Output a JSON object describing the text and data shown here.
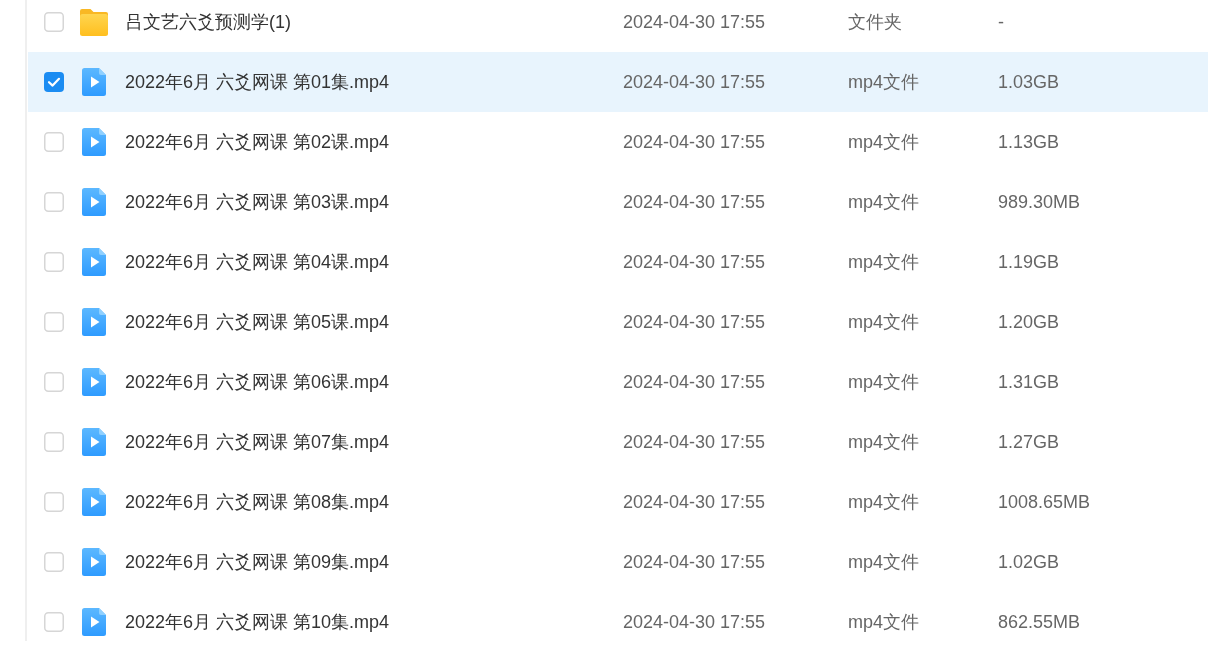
{
  "file_list": {
    "rows": [
      {
        "kind": "folder",
        "selected": false,
        "name": "吕文艺六爻预测学(1)",
        "modified": "2024-04-30 17:55",
        "type": "文件夹",
        "size": "-"
      },
      {
        "kind": "video",
        "selected": true,
        "name": "2022年6月 六爻网课 第01集.mp4",
        "modified": "2024-04-30 17:55",
        "type": "mp4文件",
        "size": "1.03GB"
      },
      {
        "kind": "video",
        "selected": false,
        "name": "2022年6月 六爻网课 第02课.mp4",
        "modified": "2024-04-30 17:55",
        "type": "mp4文件",
        "size": "1.13GB"
      },
      {
        "kind": "video",
        "selected": false,
        "name": "2022年6月 六爻网课 第03课.mp4",
        "modified": "2024-04-30 17:55",
        "type": "mp4文件",
        "size": "989.30MB"
      },
      {
        "kind": "video",
        "selected": false,
        "name": "2022年6月 六爻网课 第04课.mp4",
        "modified": "2024-04-30 17:55",
        "type": "mp4文件",
        "size": "1.19GB"
      },
      {
        "kind": "video",
        "selected": false,
        "name": "2022年6月 六爻网课 第05课.mp4",
        "modified": "2024-04-30 17:55",
        "type": "mp4文件",
        "size": "1.20GB"
      },
      {
        "kind": "video",
        "selected": false,
        "name": "2022年6月 六爻网课 第06课.mp4",
        "modified": "2024-04-30 17:55",
        "type": "mp4文件",
        "size": "1.31GB"
      },
      {
        "kind": "video",
        "selected": false,
        "name": "2022年6月 六爻网课 第07集.mp4",
        "modified": "2024-04-30 17:55",
        "type": "mp4文件",
        "size": "1.27GB"
      },
      {
        "kind": "video",
        "selected": false,
        "name": "2022年6月 六爻网课 第08集.mp4",
        "modified": "2024-04-30 17:55",
        "type": "mp4文件",
        "size": "1008.65MB"
      },
      {
        "kind": "video",
        "selected": false,
        "name": "2022年6月 六爻网课 第09集.mp4",
        "modified": "2024-04-30 17:55",
        "type": "mp4文件",
        "size": "1.02GB"
      },
      {
        "kind": "video",
        "selected": false,
        "name": "2022年6月 六爻网课 第10集.mp4",
        "modified": "2024-04-30 17:55",
        "type": "mp4文件",
        "size": "862.55MB"
      }
    ]
  }
}
